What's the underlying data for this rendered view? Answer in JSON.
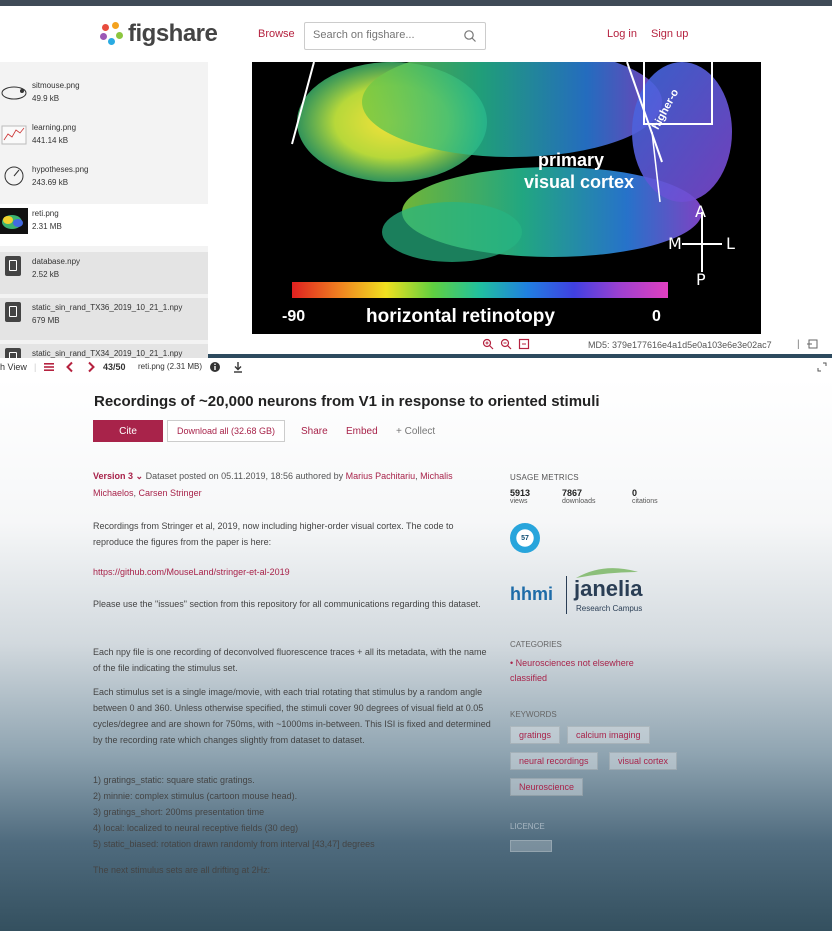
{
  "header": {
    "brand": "figshare",
    "browse": "Browse",
    "search_placeholder": "Search on figshare...",
    "login": "Log in",
    "signup": "Sign up"
  },
  "files": [
    {
      "name": "sitmouse.png",
      "size": "49.9 kB"
    },
    {
      "name": "learning.png",
      "size": "441.14 kB"
    },
    {
      "name": "hypotheses.png",
      "size": "243.69 kB"
    },
    {
      "name": "reti.png",
      "size": "2.31 MB"
    },
    {
      "name": "database.npy",
      "size": "2.52 kB"
    },
    {
      "name": "static_sin_rand_TX36_2019_10_21_1.npy",
      "size": "679 MB"
    },
    {
      "name": "static_sin_rand_TX34_2019_10_21_1.npy",
      "size": ""
    }
  ],
  "preview": {
    "annotation_primary": "primary",
    "annotation_visual": "visual cortex",
    "annotation_higher": "higher-o",
    "colorbar_min": "-90",
    "colorbar_label": "horizontal retinotopy",
    "colorbar_max": "0",
    "dir_a": "A",
    "dir_m": "M",
    "dir_l": "L",
    "dir_p": "P",
    "md5": "MD5: 379e177616e4a1d5e0a103e6e3e02ac7",
    "md5_sep": "|"
  },
  "toolbar": {
    "view": "h View",
    "position": "43/50",
    "file": "reti.png (2.31 MB)"
  },
  "article": {
    "title": "Recordings of ~20,000 neurons from V1 in response to oriented stimuli",
    "cite": "Cite",
    "download_all": "Download all (32.68 GB)",
    "share": "Share",
    "embed": "Embed",
    "collect": "+ Collect",
    "version": "Version 3",
    "posted": "Dataset posted on 05.11.2019, 18:56 authored by",
    "author1": "Marius Pachitariu",
    "author2": "Michalis Michaelos",
    "author3": "Carsen Stringer",
    "p1": "Recordings from Stringer et al, 2019, now including higher-order visual cortex. The code to reproduce the figures from the paper is here:",
    "link": "https://github.com/MouseLand/stringer-et-al-2019",
    "p2": "Please use the \"issues\" section from this repository for all communications regarding this dataset.",
    "p3": "Each npy file is one recording of deconvolved fluorescence traces + all its metadata, with the name of the file indicating the stimulus set.",
    "p4": "Each stimulus set is a single image/movie, with each trial rotating that stimulus by a random angle between 0 and 360. Unless otherwise specified, the stimuli cover 90 degrees of visual field at 0.05 cycles/degree and are shown for 750ms, with ~1000ms in-between. This ISI is fixed and determined by the recording rate which changes slightly from dataset to dataset.",
    "list": [
      "1) gratings_static: square static gratings.",
      "2) minnie: complex stimulus (cartoon mouse head).",
      "3) gratings_short: 200ms presentation time",
      "4) local: localized to neural receptive fields (30 deg)",
      "5) static_biased: rotation drawn randomly from interval [43,47] degrees"
    ],
    "p5": "The next stimulus sets are all drifting at 2Hz:"
  },
  "sidebar": {
    "usage_title": "USAGE METRICS",
    "views": "5913",
    "views_label": "views",
    "downloads": "7867",
    "downloads_label": "downloads",
    "citations": "0",
    "citations_label": "citations",
    "altmetric": "57",
    "hhmi": "hhmi",
    "janelia": "janelia",
    "janelia_sub": "Research Campus",
    "categories_title": "CATEGORIES",
    "category": "Neurosciences not elsewhere classified",
    "keywords_title": "KEYWORDS",
    "keywords": [
      "gratings",
      "calcium imaging",
      "neural recordings",
      "visual cortex",
      "Neuroscience"
    ],
    "licence_title": "LICENCE"
  },
  "colors": {
    "accent": "#a8234a",
    "header_border": "#3f4b57"
  }
}
